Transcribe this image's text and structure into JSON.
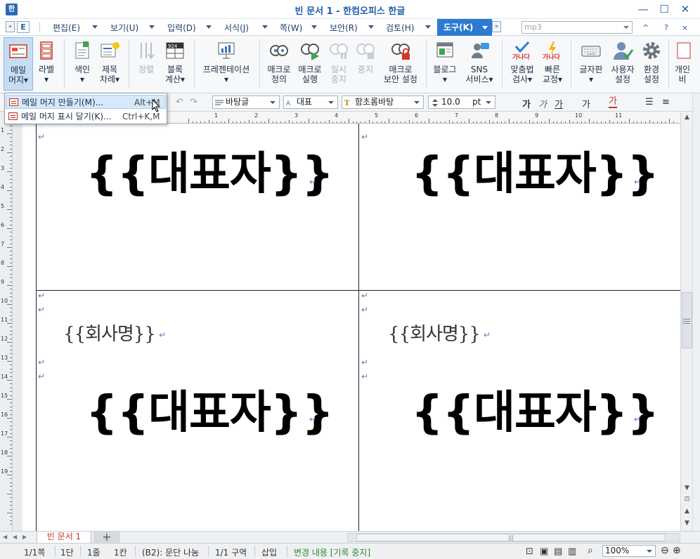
{
  "titlebar": {
    "title": "빈 문서 1 - 한컴오피스 한글",
    "minimize": "—",
    "maximize": "☐",
    "close": "✕"
  },
  "menubar": {
    "file_label": "E",
    "items": [
      "편집(E)",
      "보기(U)",
      "입력(D)",
      "서식(J)",
      "쪽(W)",
      "보안(R)",
      "검토(H)"
    ],
    "active": "도구(K)",
    "search_value": "mp3",
    "collapse_ribbon": "^",
    "help": "?",
    "close_doc": "×"
  },
  "ribbon": {
    "buttons": [
      {
        "label1": "메일",
        "label2": "머지▾"
      },
      {
        "label1": "라벨",
        "label2": "▾"
      },
      {
        "label1": "색인",
        "label2": "▾"
      },
      {
        "label1": "제목",
        "label2": "차례▾"
      },
      {
        "label1": "정렬",
        "label2": ""
      },
      {
        "label1": "블록",
        "label2": "계산▾"
      },
      {
        "label1": "프레젠테이션",
        "label2": "▾"
      },
      {
        "label1": "매크로",
        "label2": "정의"
      },
      {
        "label1": "매크로",
        "label2": "실행"
      },
      {
        "label1": "일시",
        "label2": "중지"
      },
      {
        "label1": "중지",
        "label2": ""
      },
      {
        "label1": "매크로",
        "label2": "보안 설정"
      },
      {
        "label1": "블로그",
        "label2": "▾"
      },
      {
        "label1": "SNS",
        "label2": "서비스▾"
      },
      {
        "label1": "맞춤법",
        "label2": "검사▾"
      },
      {
        "label1": "빠른",
        "label2": "교정▾"
      },
      {
        "label1": "글자판",
        "label2": "▾"
      },
      {
        "label1": "사용자",
        "label2": "설정"
      },
      {
        "label1": "환경",
        "label2": "설정"
      },
      {
        "label1": "개인",
        "label2": "비"
      }
    ],
    "icon_text_ganada": "가나다",
    "icon_text_calc": "9²⁴ 77"
  },
  "format": {
    "style": "바탕글",
    "lang": "대표",
    "font": "함초롬바탕",
    "size": "10.0",
    "unit": "pt",
    "bold": "가",
    "italic": "가",
    "underline": "가",
    "strike": "가",
    "color": "가"
  },
  "popup": {
    "items": [
      {
        "label": "메일 머지 만들기(M)...",
        "shortcut": "Alt+M"
      },
      {
        "label": "메일 머지 표시 달기(K)...",
        "shortcut": "Ctrl+K,M"
      }
    ]
  },
  "document": {
    "fields": {
      "rep": "{{대표자}}",
      "company": "{{회사명}}"
    },
    "return_mark": "↵"
  },
  "ruler": {
    "h_numbers": [
      "1",
      "2",
      "3",
      "4",
      "5",
      "6",
      "7",
      "8",
      "9",
      "10",
      "11"
    ],
    "v_numbers": [
      "1",
      "2",
      "3",
      "4",
      "5",
      "6",
      "7",
      "8",
      "9",
      "10",
      "11",
      "12",
      "13",
      "14",
      "15",
      "16",
      "17",
      "18",
      "19"
    ]
  },
  "tabs": {
    "doc_tab": "빈 문서 1",
    "add": "+",
    "scroll_grip": "|||"
  },
  "status": {
    "page": "1/1쪽",
    "column": "1단",
    "line": "1줄",
    "col_pos": "1칸",
    "para": "(B2): 문단 나눔",
    "section": "1/1 구역",
    "mode": "삽입",
    "track": "변경 내용 [기록 중지]",
    "zoom": "100%"
  },
  "colors": {
    "accent": "#2c7bd1",
    "title": "#1f5fa8",
    "track_green": "#2f8a2f"
  }
}
